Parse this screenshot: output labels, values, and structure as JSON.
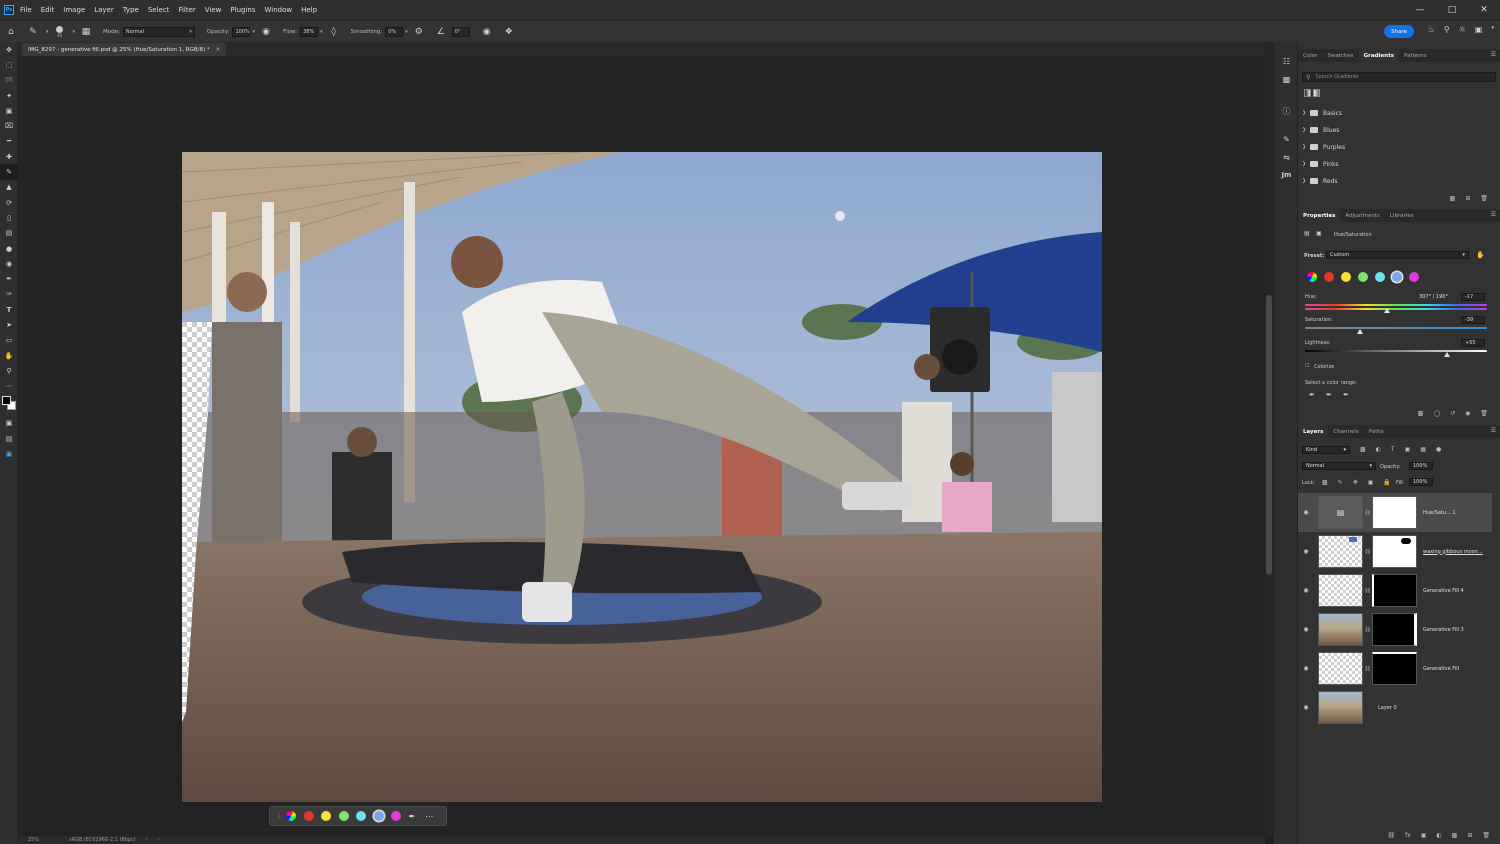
{
  "app": {
    "logo": "Ps",
    "menus": [
      "File",
      "Edit",
      "Image",
      "Layer",
      "Type",
      "Select",
      "Filter",
      "View",
      "Plugins",
      "Window",
      "Help"
    ]
  },
  "options": {
    "brush_size": "40",
    "mode_label": "Mode:",
    "mode_value": "Normal",
    "opacity_label": "Opacity:",
    "opacity_value": "100%",
    "flow_label": "Flow:",
    "flow_value": "38%",
    "smoothing_label": "Smoothing:",
    "smoothing_value": "0%",
    "angle_value": "0°",
    "share_label": "Share"
  },
  "document": {
    "tab_title": "IMG_8297 - generative fill.psd @ 25% (Hue/Saturation 1, RGB/8) *",
    "status_zoom": "25%",
    "status_profile": "sRGB IEC61966-2.1 (8bpc)"
  },
  "context_bar": {
    "colors": [
      "#6fa0ff",
      "#e0382a",
      "#f4e23a",
      "#7ee36a",
      "#6fe0f0",
      "#7aa8e8",
      "#e03ad8"
    ]
  },
  "gradients_panel": {
    "tabs": [
      "Color",
      "Swatches",
      "Gradients",
      "Patterns"
    ],
    "active_tab": "Gradients",
    "search_placeholder": "Search Gradients",
    "folders": [
      "Basics",
      "Blues",
      "Purples",
      "Pinks",
      "Reds"
    ]
  },
  "properties_panel": {
    "tabs": [
      "Properties",
      "Adjustments",
      "Libraries"
    ],
    "active_tab": "Properties",
    "adjustment_name": "Hue/Saturation",
    "preset_label": "Preset:",
    "preset_value": "Custom",
    "hue_label": "Hue:",
    "hue_range": "307° / 190°",
    "hue_value": "-17",
    "hue_level": 0.45,
    "saturation_label": "Saturation:",
    "saturation_value": "-39",
    "saturation_level": 0.3,
    "lightness_label": "Lightness:",
    "lightness_value": "+55",
    "lightness_level": 0.78,
    "colorize_label": "Colorize",
    "color_range_label": "Select a color range:",
    "colors": [
      "#4a8ee6",
      "#e0382a",
      "#f4e23a",
      "#7ee36a",
      "#6fe0f0",
      "#7aa8e8",
      "#e03ad8"
    ]
  },
  "layers_panel": {
    "tabs": [
      "Layers",
      "Channels",
      "Paths"
    ],
    "active_tab": "Layers",
    "kind_label": "Kind",
    "blend_mode": "Normal",
    "opacity_label": "Opacity:",
    "opacity_value": "100%",
    "lock_label": "Lock:",
    "fill_label": "Fill:",
    "fill_value": "100%",
    "layers": [
      {
        "name": "Hue/Satu... 1"
      },
      {
        "name": "waxing gibbous moon..."
      },
      {
        "name": "Generative Fill 4"
      },
      {
        "name": "Generative Fill 3"
      },
      {
        "name": "Generative Fill"
      },
      {
        "name": "Layer 0"
      }
    ]
  }
}
